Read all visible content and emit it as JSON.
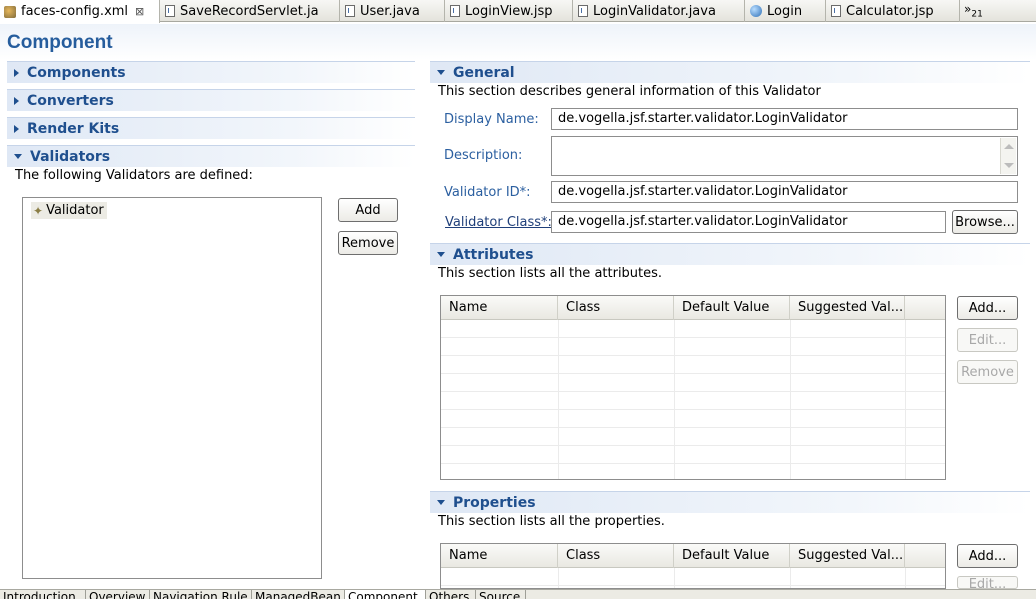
{
  "editor_tabs": [
    {
      "label": "faces-config.xml",
      "active": true
    },
    {
      "label": "SaveRecordServlet.ja"
    },
    {
      "label": "User.java"
    },
    {
      "label": "LoginView.jsp"
    },
    {
      "label": "LoginValidator.java"
    },
    {
      "label": "Login"
    },
    {
      "label": "Calculator.jsp"
    }
  ],
  "tab_overflow": {
    "chevrons": "»",
    "count": "21"
  },
  "form": {
    "title": "Component"
  },
  "left": {
    "sections": {
      "components": "Components",
      "converters": "Converters",
      "render_kits": "Render Kits",
      "validators": "Validators"
    },
    "validators_desc": "The following Validators are defined:",
    "tree_items": [
      "Validator"
    ],
    "add_label": "Add",
    "remove_label": "Remove"
  },
  "general": {
    "title": "General",
    "desc": "This section describes general information of this Validator",
    "display_name_label": "Display Name:",
    "display_name_value": "de.vogella.jsf.starter.validator.LoginValidator",
    "description_label": "Description:",
    "description_value": "",
    "validator_id_label": "Validator ID*:",
    "validator_id_value": "de.vogella.jsf.starter.validator.LoginValidator",
    "validator_class_label": "Validator Class*:",
    "validator_class_value": "de.vogella.jsf.starter.validator.LoginValidator",
    "browse_label": "Browse..."
  },
  "attributes": {
    "title": "Attributes",
    "desc": "This section lists all the attributes.",
    "columns": [
      "Name",
      "Class",
      "Default Value",
      "Suggested Val..."
    ],
    "add_label": "Add...",
    "edit_label": "Edit...",
    "remove_label": "Remove"
  },
  "properties": {
    "title": "Properties",
    "desc": "This section lists all the properties.",
    "columns": [
      "Name",
      "Class",
      "Default Value",
      "Suggested Val..."
    ],
    "add_label": "Add...",
    "edit_label": "Edit..."
  },
  "page_tabs": [
    {
      "label": "Introduction"
    },
    {
      "label": "Overview"
    },
    {
      "label": "Navigation Rule"
    },
    {
      "label": "ManagedBean"
    },
    {
      "label": "Component",
      "active": true
    },
    {
      "label": "Others"
    },
    {
      "label": "Source"
    }
  ],
  "colors": {
    "accent": "#265d9d",
    "section_text": "#1f4f8e"
  }
}
